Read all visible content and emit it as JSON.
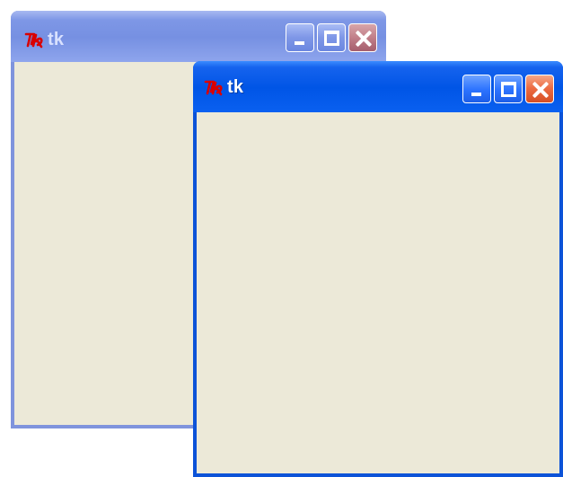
{
  "windows": {
    "back": {
      "title": "tk",
      "icon": "tk-icon",
      "controls": [
        "minimize-icon",
        "maximize-icon",
        "close-icon"
      ]
    },
    "front": {
      "title": "tk",
      "icon": "tk-icon",
      "controls": [
        "minimize-icon",
        "maximize-icon",
        "close-icon"
      ]
    }
  },
  "colors": {
    "active_titlebar": "#0c53d8",
    "inactive_titlebar": "#7f94dd",
    "client_background": "#ece9d8",
    "close_button": "#e45a2f"
  }
}
